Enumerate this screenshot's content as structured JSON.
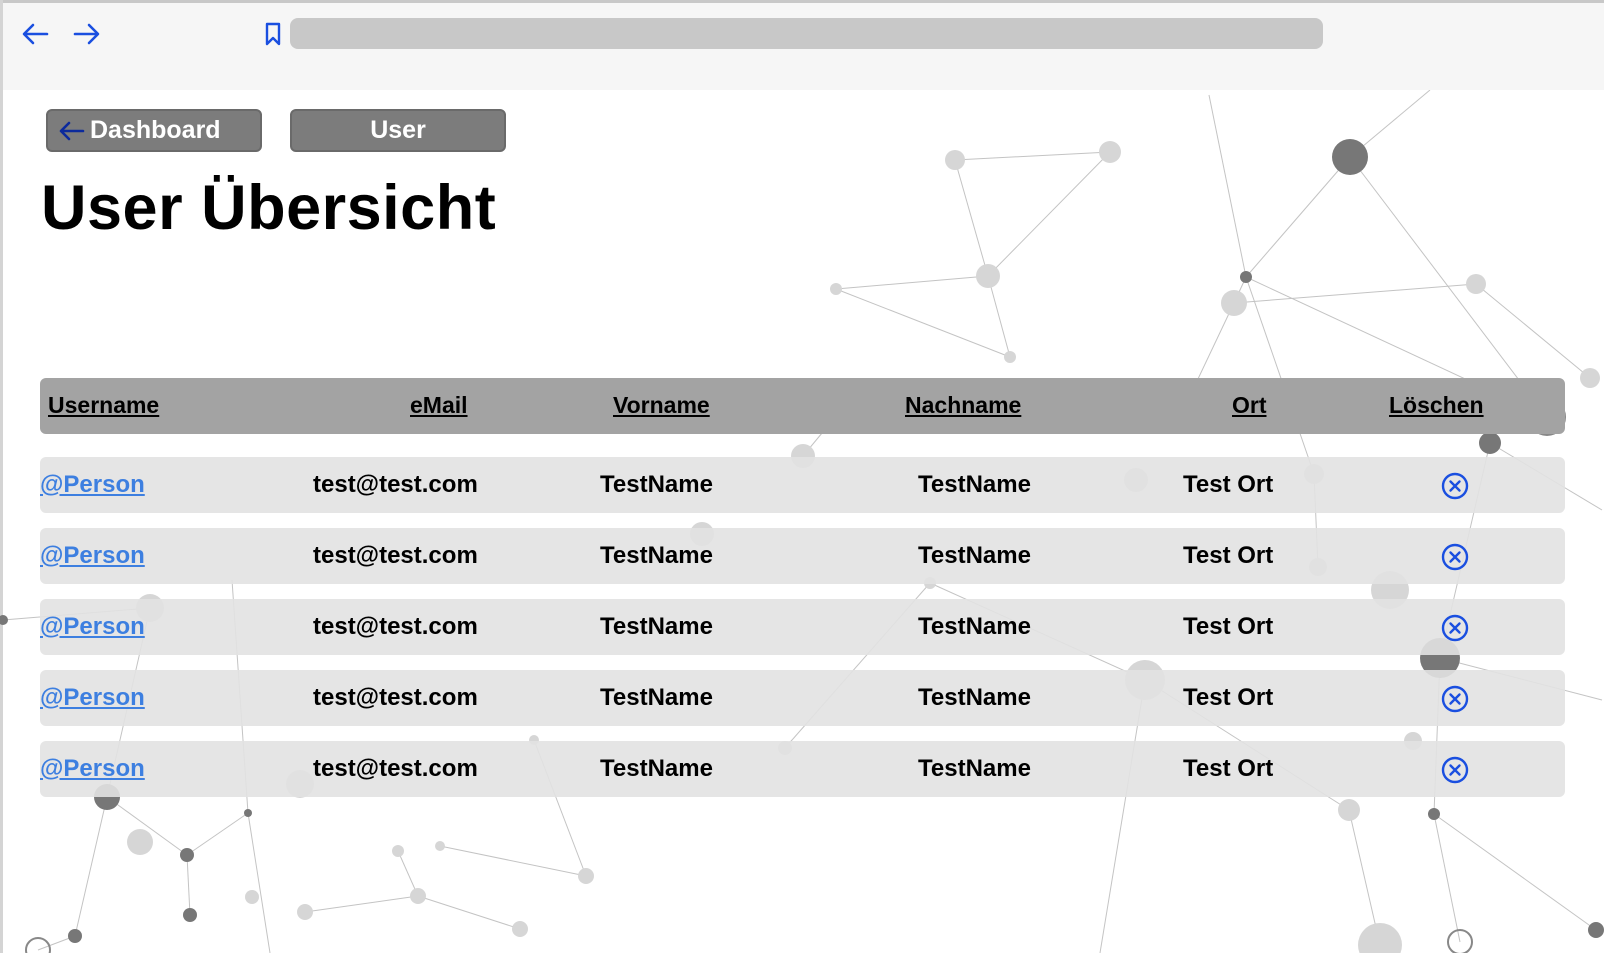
{
  "browser": {
    "back_icon": "arrow-left-icon",
    "forward_icon": "arrow-right-icon",
    "bookmark_icon": "bookmark-icon",
    "address_value": ""
  },
  "nav": {
    "dashboard_label": "Dashboard",
    "dashboard_icon": "arrow-left-icon",
    "user_label": "User"
  },
  "page": {
    "title": "User Übersicht"
  },
  "table": {
    "headers": {
      "username": "Username",
      "email": "eMail",
      "vorname": "Vorname",
      "nachname": "Nachname",
      "ort": "Ort",
      "loeschen": "Löschen"
    },
    "rows": [
      {
        "username": "@Person",
        "email": "test@test.com",
        "vorname": "TestName",
        "nachname": "TestName",
        "ort": "Test Ort"
      },
      {
        "username": "@Person",
        "email": "test@test.com",
        "vorname": "TestName",
        "nachname": "TestName",
        "ort": "Test Ort"
      },
      {
        "username": "@Person",
        "email": "test@test.com",
        "vorname": "TestName",
        "nachname": "TestName",
        "ort": "Test Ort"
      },
      {
        "username": "@Person",
        "email": "test@test.com",
        "vorname": "TestName",
        "nachname": "TestName",
        "ort": "Test Ort"
      },
      {
        "username": "@Person",
        "email": "test@test.com",
        "vorname": "TestName",
        "nachname": "TestName",
        "ort": "Test Ort"
      }
    ],
    "delete_icon": "close-circle-icon"
  },
  "colors": {
    "accent_blue": "#1a4fe0",
    "link_blue": "#3d7fe0",
    "header_gray": "#a3a3a3",
    "pill_gray": "#7c7c7c",
    "row_gray": "#e2e2e2"
  }
}
